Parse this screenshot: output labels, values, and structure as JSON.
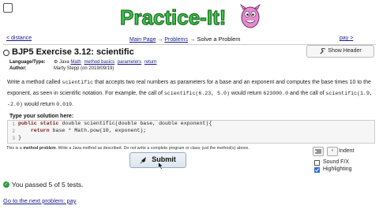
{
  "header": {
    "logo_text": "Practice-It!",
    "nav_prev": "< distance",
    "nav_main": "Main Page",
    "nav_arrow": "→",
    "nav_problems": "Problems",
    "nav_current": "→ Solve a Problem",
    "nav_next": "pay >"
  },
  "problem": {
    "title": "BJP5 Exercise 3.12: scientific",
    "show_header_label": "Show Header",
    "meta": {
      "type_label": "Language/Type:",
      "type_lang": "Java",
      "type_tags": [
        "Math",
        "method basics",
        "parameters",
        "return"
      ],
      "author_label": "Author:",
      "author": "Marty Stepp (on 2019/09/19)"
    },
    "description": {
      "p1_a": "Write a method called ",
      "p1_code": "scientific",
      "p1_b": " that accepts two real numbers as parameters for a base and an exponent and computes the base times 10 to the exponent, as seen in scientific notation. For example, the call of ",
      "p1_code2": "scientific(6.23, 5.0)",
      "p1_c": " would return ",
      "p1_code3": "623000.0",
      "p1_d": " and the call of ",
      "p1_code4": "scientific(1.9, -2.0)",
      "p1_e": " would return ",
      "p1_code5": "0.019",
      "p1_f": "."
    }
  },
  "solution": {
    "label": "Type your solution here:",
    "lines": [
      {
        "num": "1",
        "kw": "public static ",
        "code": "double scientific(double base, double exponent){"
      },
      {
        "num": "2",
        "kw": "    return ",
        "code": "base * Math.pow(10, exponent);"
      },
      {
        "num": "3",
        "kw": "",
        "code": "}"
      }
    ],
    "note_a": "This is a ",
    "note_bold": "method problem",
    "note_b": ". Write a Java method as described. Do not write a complete program or class; just the method(s) above."
  },
  "controls": {
    "submit_label": "Submit",
    "indent_label": "Indent",
    "sound_label": "Sound F/X",
    "sound_checked": false,
    "highlight_label": "Highlighting",
    "highlight_checked": true
  },
  "result": {
    "passed_text": "You passed 5 of 5 tests."
  },
  "footer": {
    "next_link": "Go to the next problem: pay"
  },
  "colors": {
    "link": "#1a1a8c",
    "logo_green": "#3cb84a",
    "pass_green": "#2e9a3a"
  }
}
